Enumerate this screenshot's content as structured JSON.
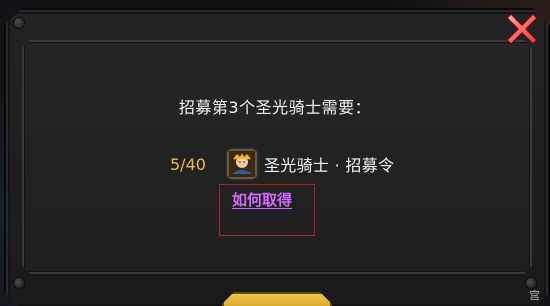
{
  "dialog": {
    "title": "招募第3个圣光骑士需要：",
    "requirement": {
      "progress": "5/40",
      "item_name": "圣光骑士 · 招募令",
      "item_icon": "knight-portrait-icon"
    },
    "how_to_get_label": "如何取得",
    "close_icon": "close-x-icon"
  },
  "background": {
    "corner_label": "宫"
  },
  "colors": {
    "panel": "#252526",
    "text": "#f3f3f3",
    "progress": "#f0b64e",
    "link": "#d86bff",
    "highlight_box": "#b02020",
    "close_x": "#ff6666",
    "button": "#f0c84a"
  }
}
